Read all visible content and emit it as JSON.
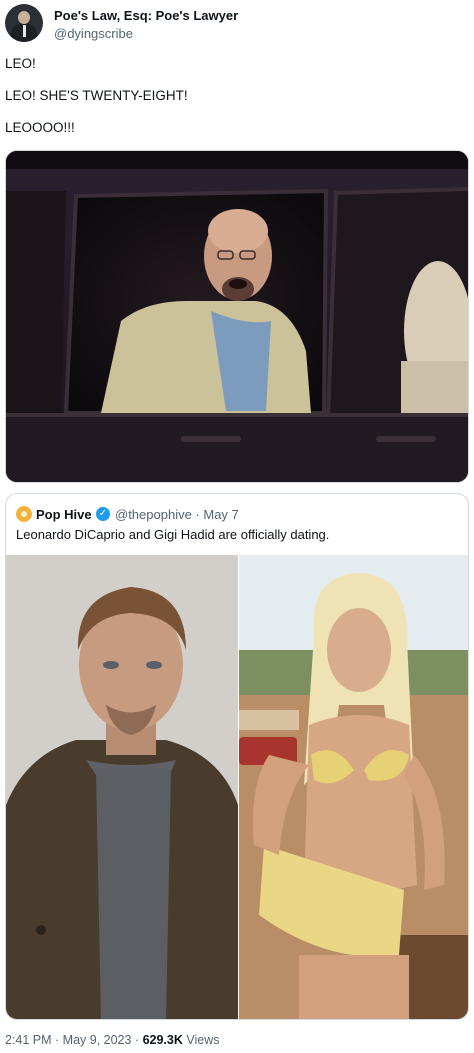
{
  "author": {
    "name": "Poe's Law, Esq: Poe's Lawyer",
    "handle": "@dyingscribe"
  },
  "tweet": {
    "lines": [
      "LEO!",
      "LEO! SHE'S TWENTY-EIGHT!",
      "LEOOOO!!!"
    ]
  },
  "quoted": {
    "name": "Pop Hive",
    "verified": "✓",
    "handle_date": "@thepophive · May 7",
    "text": "Leonardo DiCaprio and Gigi Hadid are officially dating."
  },
  "meta": {
    "time_date": "2:41 PM · May 9, 2023 · ",
    "views_count": "629.3K",
    "views_label": " Views"
  },
  "colors": {
    "text": "#0f1419",
    "secondary": "#536471",
    "verified": "#1d9bf0",
    "border": "#cfd9de"
  }
}
